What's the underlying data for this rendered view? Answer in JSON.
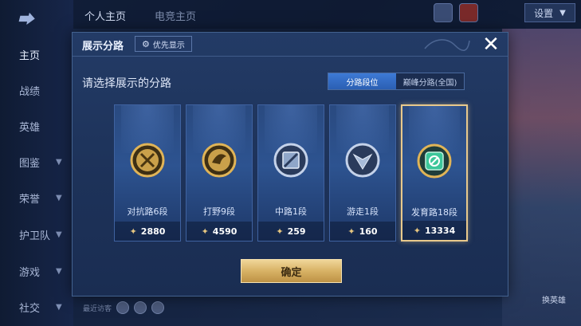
{
  "app": {
    "top_tabs": [
      "个人主页",
      "电竞主页"
    ],
    "settings_label": "设置",
    "sidebar": [
      {
        "label": "主页",
        "chevron": false,
        "active": true
      },
      {
        "label": "战绩",
        "chevron": false,
        "active": false
      },
      {
        "label": "英雄",
        "chevron": false,
        "active": false
      },
      {
        "label": "图鉴",
        "chevron": true,
        "active": false
      },
      {
        "label": "荣誉",
        "chevron": true,
        "active": false
      },
      {
        "label": "护卫队",
        "chevron": true,
        "active": false
      },
      {
        "label": "游戏",
        "chevron": true,
        "active": false
      },
      {
        "label": "社交",
        "chevron": true,
        "active": false
      }
    ],
    "recent_visitors_label": "最近访客",
    "hero_button_label": "换英雄"
  },
  "modal": {
    "title": "展示分路",
    "priority_button": "优先显示",
    "subtitle": "请选择展示的分路",
    "tabs": [
      {
        "label": "分路段位",
        "active": true
      },
      {
        "label": "巅峰分路(全国)",
        "active": false
      }
    ],
    "lanes": [
      {
        "label": "对抗路6段",
        "score": "2880",
        "icon": "clash-lane-icon",
        "selected": false,
        "color": "#d9a443"
      },
      {
        "label": "打野9段",
        "score": "4590",
        "icon": "jungle-icon",
        "selected": false,
        "color": "#d9a443"
      },
      {
        "label": "中路1段",
        "score": "259",
        "icon": "mid-lane-icon",
        "selected": false,
        "color": "#b9c9e2"
      },
      {
        "label": "游走1段",
        "score": "160",
        "icon": "roam-icon",
        "selected": false,
        "color": "#b9c9e2"
      },
      {
        "label": "发育路18段",
        "score": "13334",
        "icon": "farm-lane-icon",
        "selected": true,
        "color": "#3cc69a"
      }
    ],
    "confirm_label": "确定"
  }
}
